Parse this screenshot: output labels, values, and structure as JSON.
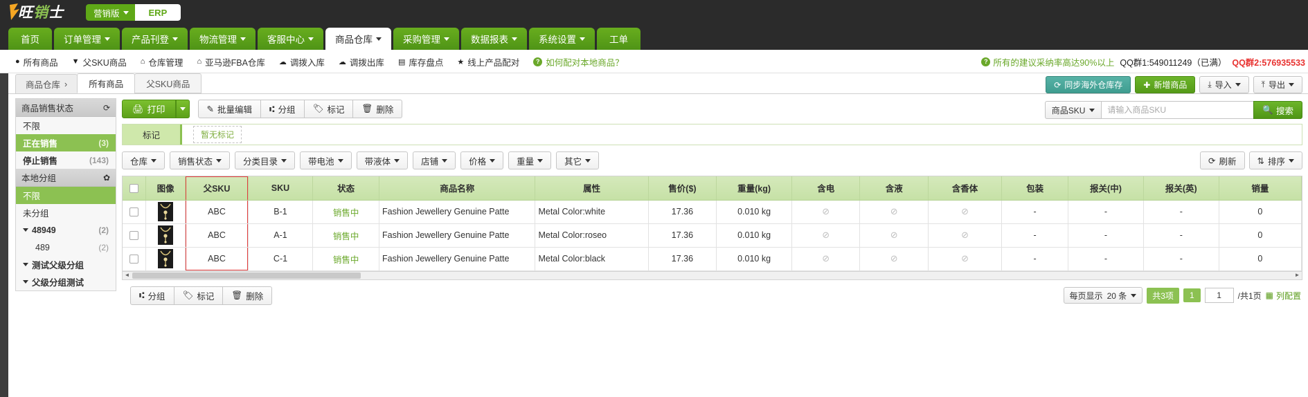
{
  "topbar": {
    "logo_alt": "旺销士",
    "version_badge": "营销版",
    "erp_badge": "ERP"
  },
  "mainnav": {
    "items": [
      {
        "label": "首页",
        "caret": false,
        "active": false
      },
      {
        "label": "订单管理",
        "caret": true,
        "active": false
      },
      {
        "label": "产品刊登",
        "caret": true,
        "active": false
      },
      {
        "label": "物流管理",
        "caret": true,
        "active": false
      },
      {
        "label": "客服中心",
        "caret": true,
        "active": false
      },
      {
        "label": "商品仓库",
        "caret": true,
        "active": true
      },
      {
        "label": "采购管理",
        "caret": true,
        "active": false
      },
      {
        "label": "数据报表",
        "caret": true,
        "active": false
      },
      {
        "label": "系统设置",
        "caret": true,
        "active": false
      },
      {
        "label": "工单",
        "caret": false,
        "active": false
      }
    ]
  },
  "subnav": {
    "items": [
      {
        "label": "所有商品",
        "icon": "circle-icon"
      },
      {
        "label": "父SKU商品",
        "icon": "funnel-icon"
      },
      {
        "label": "仓库管理",
        "icon": "home-icon"
      },
      {
        "label": "亚马逊FBA仓库",
        "icon": "home-icon"
      },
      {
        "label": "调拨入库",
        "icon": "cloud-download-icon"
      },
      {
        "label": "调拨出库",
        "icon": "cloud-upload-icon"
      },
      {
        "label": "库存盘点",
        "icon": "list-icon"
      },
      {
        "label": "线上产品配对",
        "icon": "star-icon"
      },
      {
        "label": "如何配对本地商品？",
        "icon": "question-icon"
      }
    ],
    "right": {
      "tip": "所有的建议采纳率高达90%以上",
      "qq1": "QQ群1:549011249（已满）",
      "qq2": "QQ群2:576935533"
    }
  },
  "tabs": {
    "breadcrumb": "商品仓库",
    "breadcrumb_arrow": "›",
    "items": [
      {
        "label": "所有商品",
        "active": true
      },
      {
        "label": "父SKU商品",
        "active": false
      }
    ]
  },
  "header_actions": [
    {
      "label": "同步海外仓库存",
      "style": "teal",
      "icon": "refresh-icon"
    },
    {
      "label": "新增商品",
      "style": "green",
      "icon": "plus-icon"
    },
    {
      "label": "导入",
      "style": "grey",
      "icon": "download-icon",
      "caret": true
    },
    {
      "label": "导出",
      "style": "grey",
      "icon": "upload-icon",
      "caret": true
    }
  ],
  "sidebar": {
    "section1": {
      "title": "商品销售状态",
      "icon": "refresh-icon",
      "items": [
        {
          "label": "不限",
          "count": "",
          "selected": false,
          "bold": false
        },
        {
          "label": "正在销售",
          "count": "(3)",
          "selected": true,
          "bold": true
        },
        {
          "label": "停止销售",
          "count": "(143)",
          "selected": false,
          "bold": true
        }
      ]
    },
    "section2": {
      "title": "本地分组",
      "icon": "gear-icon",
      "items": [
        {
          "label": "不限",
          "count": "",
          "selected": true,
          "bold": false,
          "tri": false,
          "indent": false
        },
        {
          "label": "未分组",
          "count": "",
          "selected": false,
          "bold": false,
          "tri": false,
          "indent": false
        },
        {
          "label": "48949",
          "count": "(2)",
          "selected": false,
          "bold": true,
          "tri": true,
          "indent": false
        },
        {
          "label": "489",
          "count": "(2)",
          "selected": false,
          "bold": false,
          "tri": false,
          "indent": true
        },
        {
          "label": "测试父级分组",
          "count": "",
          "selected": false,
          "bold": true,
          "tri": true,
          "indent": false
        },
        {
          "label": "父级分组测试",
          "count": "",
          "selected": false,
          "bold": true,
          "tri": true,
          "indent": false
        }
      ]
    }
  },
  "toolbar": {
    "print_label": "打印",
    "print_icon": "printer-icon",
    "buttons": [
      {
        "label": "批量编辑",
        "icon": "edit-icon"
      },
      {
        "label": "分组",
        "icon": "group-icon"
      },
      {
        "label": "标记",
        "icon": "tag-icon"
      },
      {
        "label": "删除",
        "icon": "trash-icon"
      }
    ]
  },
  "markrow": {
    "label": "标记",
    "empty_text": "暂无标记"
  },
  "filters": {
    "items": [
      {
        "label": "仓库"
      },
      {
        "label": "销售状态"
      },
      {
        "label": "分类目录"
      },
      {
        "label": "带电池"
      },
      {
        "label": "带液体"
      },
      {
        "label": "店铺"
      },
      {
        "label": "价格"
      },
      {
        "label": "重量"
      },
      {
        "label": "其它"
      }
    ],
    "right": [
      {
        "label": "刷新",
        "icon": "refresh-icon"
      },
      {
        "label": "排序",
        "icon": "sort-icon",
        "caret": true
      }
    ]
  },
  "search": {
    "field_label": "商品SKU",
    "placeholder": "请输入商品SKU",
    "button_label": "搜索",
    "button_icon": "search-icon"
  },
  "table": {
    "columns": [
      "",
      "图像",
      "父SKU",
      "SKU",
      "状态",
      "商品名称",
      "属性",
      "售价($)",
      "重量(kg)",
      "含电",
      "含液",
      "含香体",
      "包装",
      "报关(中)",
      "报关(英)",
      "销量"
    ],
    "rows": [
      {
        "checked": false,
        "image": "necklace-thumbnail",
        "parent_sku": "ABC",
        "sku": "B-1",
        "status": "销售中",
        "name": "Fashion Jewellery Genuine Patte",
        "attribute": "Metal Color:white",
        "price": "17.36",
        "weight": "0.010 kg",
        "battery": "⊘",
        "liquid": "⊘",
        "perfume": "⊘",
        "packaging": "-",
        "customs_cn": "-",
        "customs_en": "-",
        "sales": "0"
      },
      {
        "checked": false,
        "image": "necklace-thumbnail",
        "parent_sku": "ABC",
        "sku": "A-1",
        "status": "销售中",
        "name": "Fashion Jewellery Genuine Patte",
        "attribute": "Metal Color:roseo",
        "price": "17.36",
        "weight": "0.010 kg",
        "battery": "⊘",
        "liquid": "⊘",
        "perfume": "⊘",
        "packaging": "-",
        "customs_cn": "-",
        "customs_en": "-",
        "sales": "0"
      },
      {
        "checked": false,
        "image": "necklace-thumbnail",
        "parent_sku": "ABC",
        "sku": "C-1",
        "status": "销售中",
        "name": "Fashion Jewellery Genuine Patte",
        "attribute": "Metal Color:black",
        "price": "17.36",
        "weight": "0.010 kg",
        "battery": "⊘",
        "liquid": "⊘",
        "perfume": "⊘",
        "packaging": "-",
        "customs_cn": "-",
        "customs_en": "-",
        "sales": "0"
      }
    ]
  },
  "footer": {
    "buttons": [
      {
        "label": "分组",
        "icon": "group-icon"
      },
      {
        "label": "标记",
        "icon": "tag-icon"
      },
      {
        "label": "删除",
        "icon": "trash-icon"
      }
    ],
    "pager": {
      "per_page_label": "每页显示",
      "per_page_value": "20 条",
      "total_label": "共3项",
      "page_badge": "1",
      "page_input": "1",
      "total_pages": "/共1页",
      "columns_label": "列配置"
    }
  },
  "colors": {
    "brand_green": "#5fa817",
    "accent_green": "#8cc152",
    "header_green": "#c6e1a6",
    "dark": "#2b2b2b",
    "red": "#e8312f",
    "teal": "#3f9d90"
  }
}
